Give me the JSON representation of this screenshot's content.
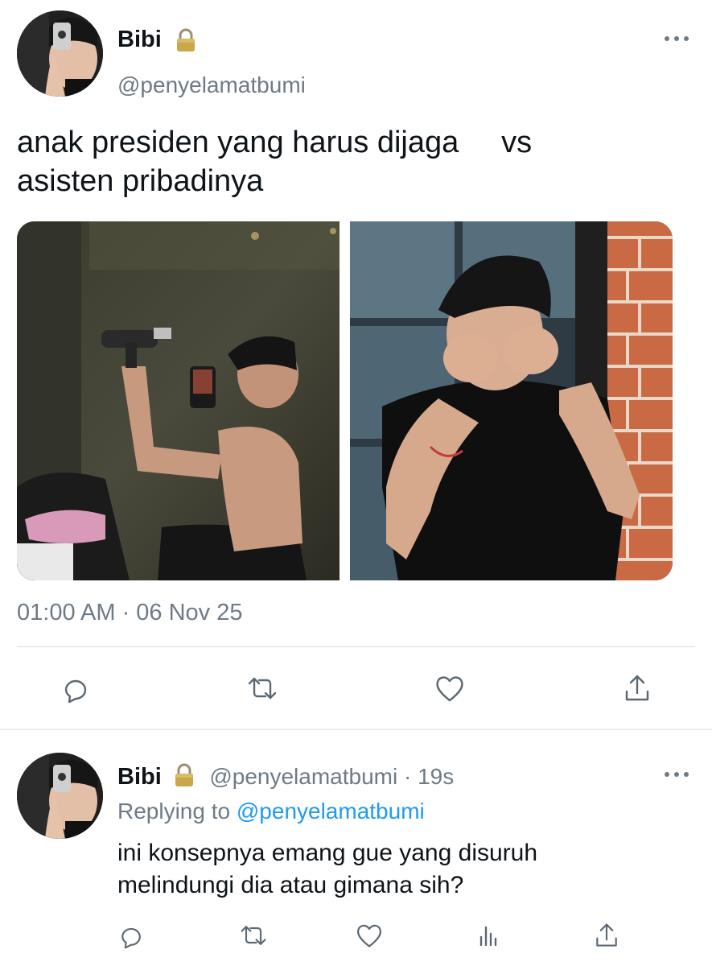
{
  "tweet": {
    "author_name": "Bibi",
    "author_handle": "@penyelamatbumi",
    "text_line1": "anak presiden yang harus dijaga     vs",
    "text_line2": "asisten pribadinya",
    "timestamp": "01:00 AM · 06 Nov 25",
    "icons": {
      "lock": "lock-icon",
      "more": "more-icon",
      "reply": "reply-icon",
      "retweet": "retweet-icon",
      "like": "heart-icon",
      "share": "share-icon"
    }
  },
  "reply": {
    "author_name": "Bibi",
    "author_handle": "@penyelamatbumi",
    "time_ago": "· 19s",
    "replying_prefix": "Replying to",
    "replying_handle": "@penyelamatbumi",
    "text_line1": "ini konsepnya emang gue yang disuruh",
    "text_line2": "melindungi dia atau gimana sih?",
    "icons": {
      "reply": "reply-icon",
      "retweet": "retweet-icon",
      "like": "heart-icon",
      "analytics": "analytics-icon",
      "share": "share-icon"
    }
  },
  "colors": {
    "link": "#1d9bf0",
    "secondary_text": "#6e7b86",
    "primary_text": "#0f1419"
  }
}
